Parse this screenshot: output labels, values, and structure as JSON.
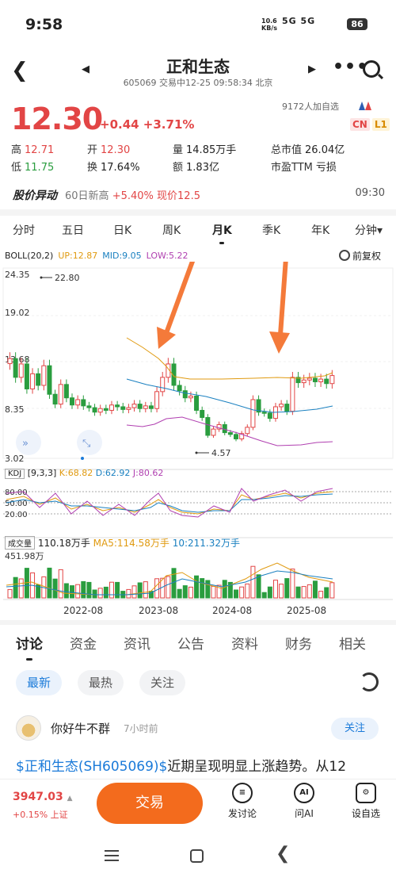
{
  "status": {
    "time": "9:58",
    "net_speed": "10.6",
    "net_unit": "KB/s",
    "signal": "5G 5G",
    "battery": "86"
  },
  "header": {
    "title": "正和生态",
    "subtitle": "605069 交易中12-25 09:58:34 北京",
    "prev": "◀",
    "next": "▶",
    "more": "•••"
  },
  "quote": {
    "price": "12.30",
    "change": "+0.44 +3.71%",
    "watchers": "9172人加自选",
    "cn": "CN",
    "l1": "L1",
    "high_label": "高",
    "high": "12.71",
    "open_label": "开",
    "open": "12.30",
    "vol_label": "量",
    "vol": "14.85万手",
    "cap_label": "总市值",
    "cap": "26.04亿",
    "low_label": "低",
    "low": "11.75",
    "turn_label": "换",
    "turn": "17.64%",
    "amt_label": "额",
    "amt": "1.83亿",
    "pe_label": "市盈TTM",
    "pe": "亏损"
  },
  "alert": {
    "tag": "股价异动",
    "text": "60日新高",
    "pct": "+5.40%",
    "now": "现价12.5",
    "time": "09:30"
  },
  "period_tabs": [
    "分时",
    "五日",
    "日K",
    "周K",
    "月K",
    "季K",
    "年K",
    "分钟▾"
  ],
  "boll": {
    "label": "BOLL(20,2)",
    "up": "UP:12.87",
    "mid": "MID:9.05",
    "low": "LOW:5.22",
    "adjust": "前复权"
  },
  "y_labels": {
    "top": "24.35",
    "high": "22.80",
    "mid1": "19.02",
    "mid2": "13.68",
    "mid3": "8.35",
    "bottom": "3.02",
    "low_mark": "4.57"
  },
  "kdj": {
    "label": "KDJ",
    "params": "[9,3,3]",
    "k": "K:68.82",
    "d": "D:62.92",
    "j": "J:80.62",
    "l80": "80.00",
    "l50": "50.00",
    "l20": "20.00"
  },
  "volume": {
    "label": "成交量",
    "value": "110.18万手",
    "ma5": "MA5:114.58万手",
    "ma10": "10:211.32万手",
    "max": "451.98万"
  },
  "x_labels": [
    "2022-08",
    "2023-08",
    "2024-08",
    "2025-08"
  ],
  "colors": {
    "up": "#e24545",
    "down": "#2a9d3f",
    "accent": "#f36b1d",
    "link": "#1a7ad9",
    "arrow": "#f47a3a"
  },
  "chart_data": {
    "type": "candlestick",
    "period": "monthly",
    "y_range": [
      3.02,
      24.35
    ],
    "annotations": {
      "max": 22.8,
      "min": 4.57
    },
    "closes": [
      14.2,
      12.1,
      13.6,
      10.8,
      12.5,
      11.2,
      13.4,
      10.2,
      9.1,
      11.3,
      9.8,
      9.0,
      9.6,
      8.9,
      8.7,
      8.2,
      8.6,
      8.4,
      9.0,
      8.8,
      8.5,
      8.7,
      9.1,
      8.6,
      8.9,
      8.6,
      10.5,
      12.1,
      13.6,
      11.2,
      10.6,
      9.8,
      10.0,
      8.4,
      7.6,
      5.6,
      6.3,
      6.8,
      5.9,
      5.7,
      5.2,
      5.8,
      6.5,
      9.6,
      8.2,
      8.1,
      7.5,
      8.8,
      9.1,
      8.3,
      12.1,
      11.5,
      11.8,
      12.0,
      11.6,
      11.9,
      11.4,
      12.3
    ],
    "series_labels": [
      "UP",
      "MID",
      "LOW"
    ]
  },
  "content_tabs": [
    "讨论",
    "资金",
    "资讯",
    "公告",
    "资料",
    "财务",
    "相关"
  ],
  "filters": [
    "最新",
    "最热",
    "关注"
  ],
  "post": {
    "user": "你好牛不群",
    "time": "7小时前",
    "follow": "关注",
    "link_text": "$正和生态(SH605069)$",
    "text": "近期呈现明显上涨趋势。从12"
  },
  "bottom": {
    "index_value": "3947.03",
    "index_change": "+0.15% 上证",
    "trade": "交易",
    "discuss": "发讨论",
    "ai": "问AI",
    "watchlist": "设自选"
  }
}
